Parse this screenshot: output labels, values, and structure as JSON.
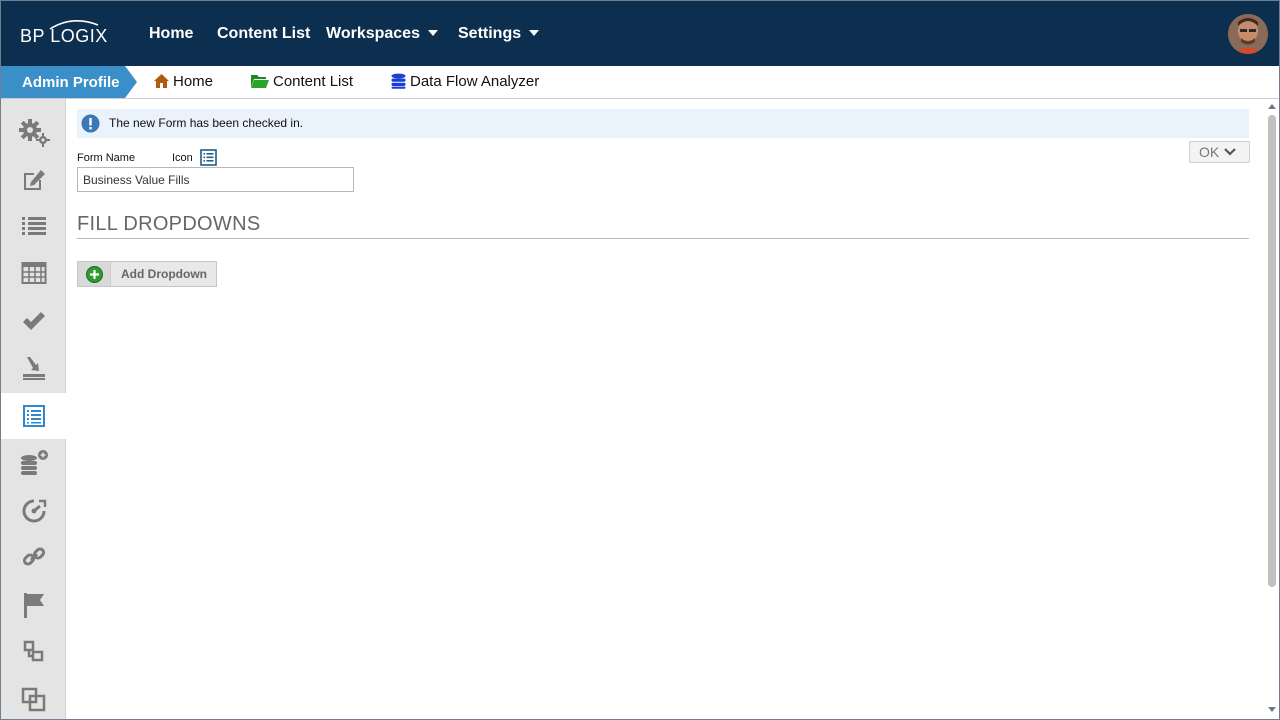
{
  "topnav": {
    "logo_text": "BP LOGIX",
    "items": [
      {
        "label": "Home"
      },
      {
        "label": "Content List"
      },
      {
        "label": "Workspaces"
      },
      {
        "label": "Settings"
      }
    ],
    "background": "#0d2f4f"
  },
  "breadcrumb": {
    "admin_profile": "Admin Profile",
    "links": [
      {
        "label": "Home",
        "icon": "home-icon",
        "color": "#b05a10"
      },
      {
        "label": "Content List",
        "icon": "folder-open-icon",
        "color": "#1d8a1d"
      },
      {
        "label": "Data Flow Analyzer",
        "icon": "database-icon",
        "color": "#1a3fd6"
      }
    ],
    "admin_color": "#3a8fc9"
  },
  "sidebar": {
    "items": [
      {
        "icon": "gears-icon"
      },
      {
        "icon": "edit-icon"
      },
      {
        "icon": "list-icon"
      },
      {
        "icon": "table-icon"
      },
      {
        "icon": "checkmark-icon"
      },
      {
        "icon": "download-tray-icon"
      },
      {
        "icon": "form-list-icon",
        "active": true
      },
      {
        "icon": "database-add-icon"
      },
      {
        "icon": "speedometer-icon"
      },
      {
        "icon": "link-icon"
      },
      {
        "icon": "flag-icon"
      },
      {
        "icon": "hierarchy-icon"
      },
      {
        "icon": "overlap-icon"
      }
    ],
    "active_color": "#2e88c9"
  },
  "notice": {
    "text": "The new Form has been checked in."
  },
  "ok_button": {
    "label": "OK"
  },
  "form": {
    "name_label": "Form Name",
    "icon_label": "Icon",
    "name_value": "Business Value Fills"
  },
  "section": {
    "title": "FILL DROPDOWNS"
  },
  "add_dropdown": {
    "label": "Add Dropdown"
  }
}
